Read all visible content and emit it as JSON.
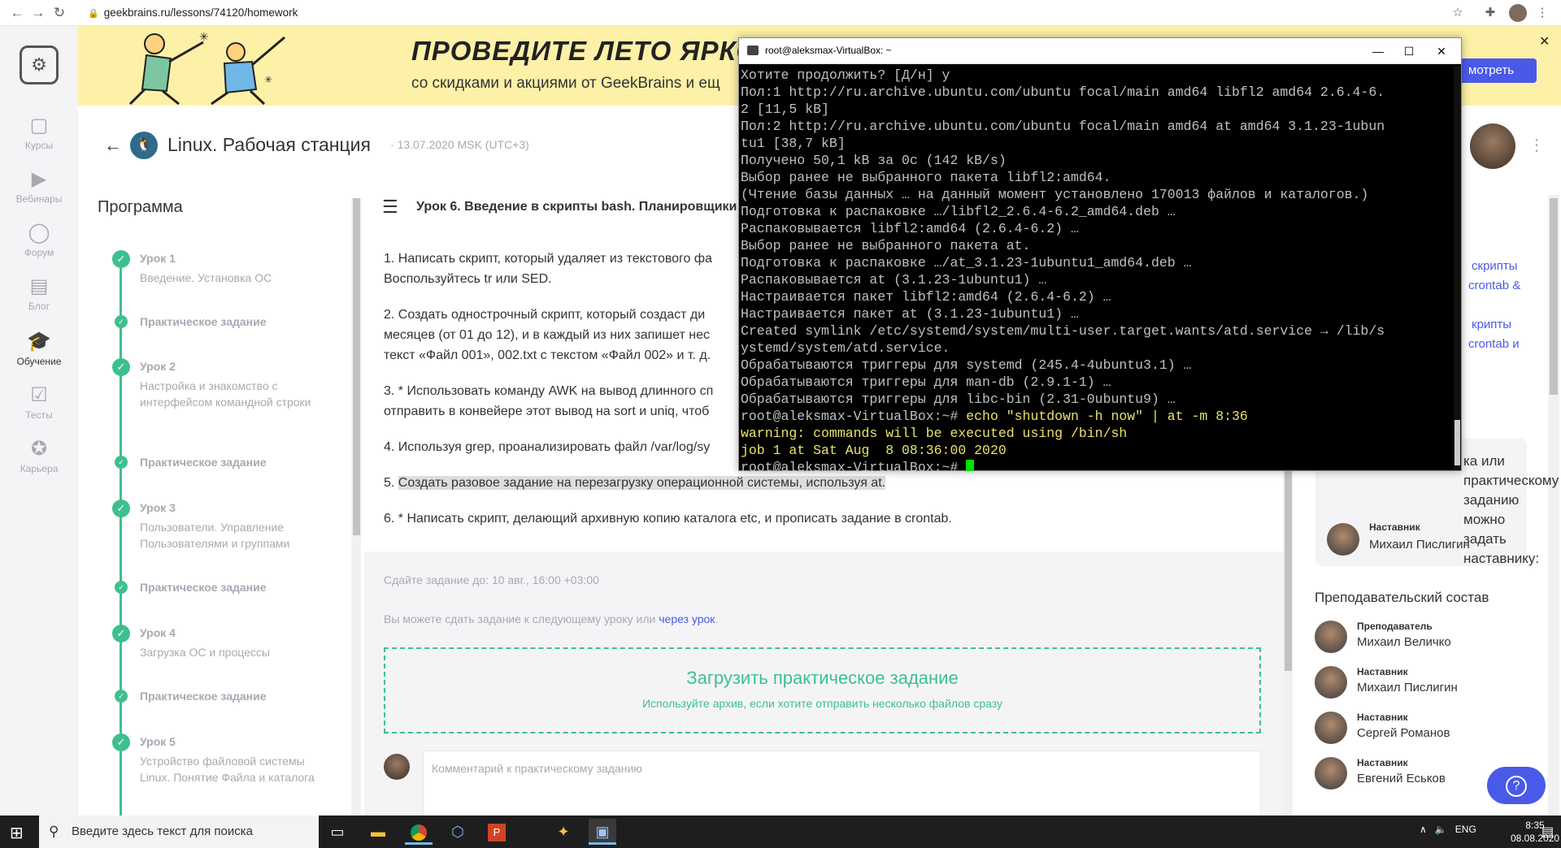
{
  "browser": {
    "url": "geekbrains.ru/lessons/74120/homework"
  },
  "leftnav": [
    {
      "label": "Курсы",
      "icon": "courses-icon"
    },
    {
      "label": "Вебинары",
      "icon": "webinars-icon"
    },
    {
      "label": "Форум",
      "icon": "forum-icon"
    },
    {
      "label": "Блог",
      "icon": "blog-icon"
    },
    {
      "label": "Обучение",
      "icon": "learning-icon",
      "active": true
    },
    {
      "label": "Тесты",
      "icon": "tests-icon"
    },
    {
      "label": "Карьера",
      "icon": "career-icon"
    }
  ],
  "banner": {
    "title": "ПРОВЕДИТЕ ЛЕТО ЯРКО",
    "subtitle": "со скидками и акциями от GeekBrains и ещ",
    "button": "мотреть"
  },
  "course": {
    "title": "Linux. Рабочая станция",
    "date": "13.07.2020 MSK (UTC+3)"
  },
  "program": {
    "title": "Программа",
    "lessons": [
      {
        "title": "Урок 1",
        "desc": "Введение. Установка ОС"
      },
      {
        "title": "Урок 2",
        "desc": "Настройка и знакомство с интерфейсом командной строки"
      },
      {
        "title": "Урок 3",
        "desc": "Пользователи. Управление Пользователями и группами"
      },
      {
        "title": "Урок 4",
        "desc": "Загрузка ОС и процессы"
      },
      {
        "title": "Урок 5",
        "desc": "Устройство файловой системы Linux. Понятие Файла и каталога"
      }
    ],
    "practice_label": "Практическое задание"
  },
  "lesson": {
    "title": "Урок 6. Введение в скрипты bash. Планировщики",
    "tasks": [
      "1. Написать скрипт, который удаляет из текстового фа",
      "Воспользуйтесь tr или SED.",
      "2. Создать однострочный скрипт, который создаст ди",
      "месяцев (от 01 до 12), и в каждый из них запишет нес",
      "текст «Файл 001», 002.txt с текстом «Файл 002» и т. д.",
      "3. * Использовать команду AWK на вывод длинного сп",
      "отправить в конвейере этот вывод на sort и uniq, чтоб",
      "4. Используя grep, проанализировать файл /var/log/sy",
      "5. ",
      "Создать разовое задание на перезагрузку операционной системы, используя at.",
      "6. * Написать скрипт, делающий архивную копию каталога etc, и прописать задание в crontab."
    ],
    "deadline": "Сдайте задание до: 10 авг., 16:00 +03:00",
    "through_text": "Вы можете сдать задание к следующему уроку или ",
    "through_link": "через урок",
    "through_end": ".",
    "upload_title": "Загрузить практическое задание",
    "upload_hint": "Используйте архив, если хотите отправить несколько файлов сразу",
    "comment_placeholder": "Комментарий к практическому заданию"
  },
  "right": {
    "links": [
      "скрипты",
      "crontab &",
      "крипты",
      "crontab и"
    ],
    "ask_text": "ка или практическому заданию можно задать наставнику:",
    "mentor": {
      "role": "Наставник",
      "name": "Михаил Пислигин"
    },
    "staff_title": "Преподавательский состав",
    "staff": [
      {
        "role": "Преподаватель",
        "name": "Михаил Величко"
      },
      {
        "role": "Наставник",
        "name": "Михаил Пислигин"
      },
      {
        "role": "Наставник",
        "name": "Сергей Романов"
      },
      {
        "role": "Наставник",
        "name": "Евгений Еськов"
      }
    ],
    "help": "?"
  },
  "terminal": {
    "title": "root@aleksmax-VirtualBox: ~",
    "lines": [
      {
        "t": "Хотите продолжить? [Д/н] y",
        "c": ""
      },
      {
        "t": "Пол:1 http://ru.archive.ubuntu.com/ubuntu focal/main amd64 libfl2 amd64 2.6.4-6.",
        "c": ""
      },
      {
        "t": "2 [11,5 kB]",
        "c": ""
      },
      {
        "t": "Пол:2 http://ru.archive.ubuntu.com/ubuntu focal/main amd64 at amd64 3.1.23-1ubun",
        "c": ""
      },
      {
        "t": "tu1 [38,7 kB]",
        "c": ""
      },
      {
        "t": "Получено 50,1 kB за 0с (142 kB/s)",
        "c": ""
      },
      {
        "t": "Выбор ранее не выбранного пакета libfl2:amd64.",
        "c": ""
      },
      {
        "t": "(Чтение базы данных … на данный момент установлено 170013 файлов и каталогов.)",
        "c": ""
      },
      {
        "t": "Подготовка к распаковке …/libfl2_2.6.4-6.2_amd64.deb …",
        "c": ""
      },
      {
        "t": "Распаковывается libfl2:amd64 (2.6.4-6.2) …",
        "c": ""
      },
      {
        "t": "Выбор ранее не выбранного пакета at.",
        "c": ""
      },
      {
        "t": "Подготовка к распаковке …/at_3.1.23-1ubuntu1_amd64.deb …",
        "c": ""
      },
      {
        "t": "Распаковывается at (3.1.23-1ubuntu1) …",
        "c": ""
      },
      {
        "t": "Настраивается пакет libfl2:amd64 (2.6.4-6.2) …",
        "c": ""
      },
      {
        "t": "Настраивается пакет at (3.1.23-1ubuntu1) …",
        "c": ""
      },
      {
        "t": "Created symlink /etc/systemd/system/multi-user.target.wants/atd.service → /lib/s",
        "c": ""
      },
      {
        "t": "ystemd/system/atd.service.",
        "c": ""
      },
      {
        "t": "Обрабатываются триггеры для systemd (245.4-4ubuntu3.1) …",
        "c": ""
      },
      {
        "t": "Обрабатываются триггеры для man-db (2.9.1-1) …",
        "c": ""
      },
      {
        "t": "Обрабатываются триггеры для libc-bin (2.31-0ubuntu9) …",
        "c": ""
      },
      {
        "t": "root@aleksmax-VirtualBox:~# ",
        "c": "",
        "y": "echo \"shutdown -h now\" | at -m 8:36"
      },
      {
        "t": "warning: commands will be executed using /bin/sh",
        "c": "y"
      },
      {
        "t": "job 1 at Sat Aug  8 08:36:00 2020",
        "c": "y"
      },
      {
        "t": "root@aleksmax-VirtualBox:~# ",
        "c": "",
        "cursor": true
      }
    ]
  },
  "taskbar": {
    "search_placeholder": "Введите здесь текст для поиска",
    "lang": "ENG",
    "time": "8:35",
    "date": "08.08.2020"
  }
}
